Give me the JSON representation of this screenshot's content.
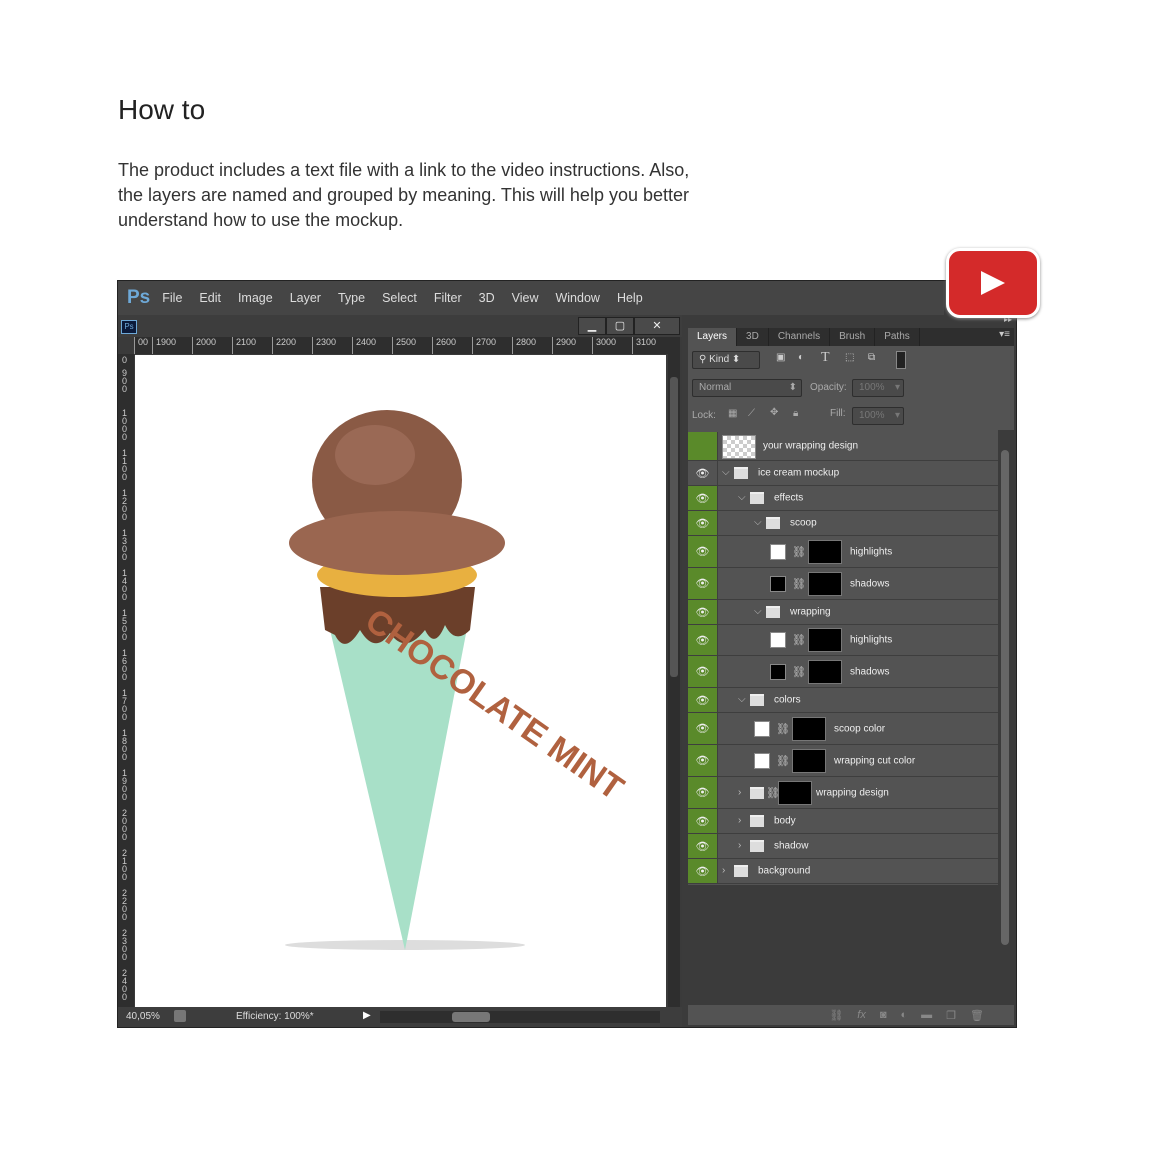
{
  "heading": "How to",
  "description": "The product includes a text file with a link to the video instructions. Also, the layers are named and grouped by meaning. This will help you better understand how to use the mockup.",
  "app": {
    "logo": "Ps",
    "menu": [
      "File",
      "Edit",
      "Image",
      "Layer",
      "Type",
      "Select",
      "Filter",
      "3D",
      "View",
      "Window",
      "Help"
    ]
  },
  "document": {
    "icon": "Ps",
    "ruler_h": [
      "00",
      "1900",
      "2000",
      "2100",
      "2200",
      "2300",
      "2400",
      "2500",
      "2600",
      "2700",
      "2800",
      "2900",
      "3000",
      "3100"
    ],
    "ruler_v": [
      "0",
      "900",
      "1000",
      "1100",
      "1200",
      "1300",
      "1400",
      "1500",
      "1600",
      "1700",
      "1800",
      "1900",
      "2000",
      "2100",
      "2200",
      "2300",
      "2400"
    ],
    "zoom": "40,05%",
    "status": "Efficiency: 100%*",
    "artwork_text": "CHOCOLATE MINT"
  },
  "panel": {
    "tabs": [
      "Layers",
      "3D",
      "Channels",
      "Brush",
      "Paths"
    ],
    "filter_kind": "Kind",
    "blend_mode": "Normal",
    "opacity_label": "Opacity:",
    "opacity": "100%",
    "lock_label": "Lock:",
    "fill_label": "Fill:",
    "fill": "100%",
    "layers": [
      {
        "name": "your wrapping design",
        "type": "smart",
        "indent": 0,
        "visible": false
      },
      {
        "name": "ice cream mockup",
        "type": "folder",
        "indent": 0,
        "expanded": true,
        "visible": true
      },
      {
        "name": "effects",
        "type": "folder",
        "indent": 1,
        "expanded": true,
        "visible": true
      },
      {
        "name": "scoop",
        "type": "folder",
        "indent": 2,
        "expanded": true,
        "visible": true
      },
      {
        "name": "highlights",
        "type": "adj",
        "indent": 3,
        "swatch": "#ffffff",
        "visible": true
      },
      {
        "name": "shadows",
        "type": "adj",
        "indent": 3,
        "swatch": "#000000",
        "visible": true
      },
      {
        "name": "wrapping",
        "type": "folder",
        "indent": 2,
        "expanded": true,
        "visible": true
      },
      {
        "name": "highlights",
        "type": "adj",
        "indent": 3,
        "swatch": "#ffffff",
        "visible": true
      },
      {
        "name": "shadows",
        "type": "adj",
        "indent": 3,
        "swatch": "#000000",
        "visible": true
      },
      {
        "name": "colors",
        "type": "folder",
        "indent": 1,
        "expanded": true,
        "visible": true
      },
      {
        "name": "scoop color",
        "type": "adj",
        "indent": 2,
        "swatch": "#ffffff",
        "visible": true
      },
      {
        "name": "wrapping cut color",
        "type": "adj",
        "indent": 2,
        "swatch": "#ffffff",
        "visible": true
      },
      {
        "name": "wrapping design",
        "type": "foldermask",
        "indent": 1,
        "expanded": false,
        "visible": true
      },
      {
        "name": "body",
        "type": "folder",
        "indent": 1,
        "expanded": false,
        "visible": true
      },
      {
        "name": "shadow",
        "type": "folder",
        "indent": 1,
        "expanded": false,
        "visible": true
      },
      {
        "name": "background",
        "type": "folder",
        "indent": 0,
        "expanded": false,
        "visible": true
      }
    ]
  },
  "colors": {
    "eye_bg": "#5a8a2a",
    "youtube": "#d42a2a",
    "ps_blue": "#6ea9d8"
  }
}
